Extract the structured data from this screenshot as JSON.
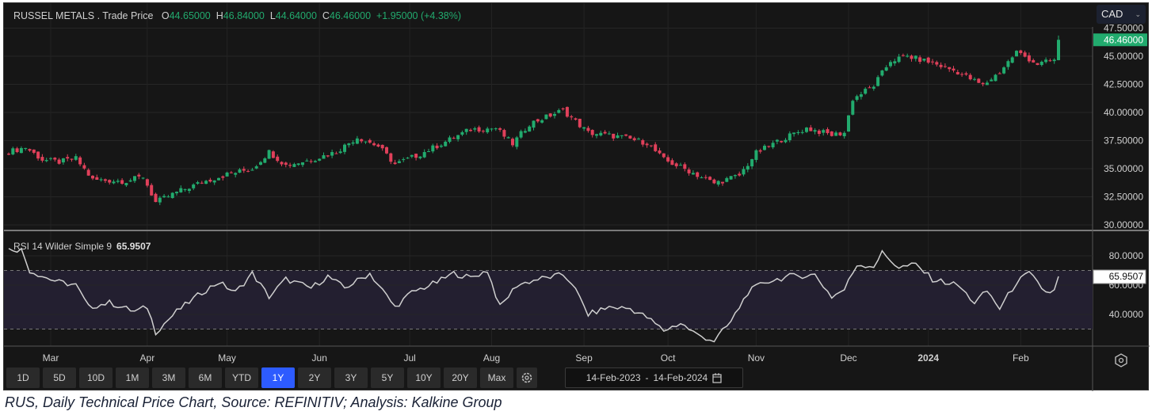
{
  "header": {
    "title": "RUSSEL METALS . Trade Price",
    "open_label": "O",
    "open": "44.65000",
    "high_label": "H",
    "high": "46.84000",
    "low_label": "L",
    "low": "44.64000",
    "close_label": "C",
    "close": "46.46000",
    "change": "+1.95000 (+4.38%)"
  },
  "currency": {
    "selected": "CAD"
  },
  "rsi": {
    "label": "RSI 14 Wilder Simple 9",
    "value": "65.9507"
  },
  "toolbar": {
    "ranges": [
      "1D",
      "5D",
      "10D",
      "1M",
      "3M",
      "6M",
      "YTD",
      "1Y",
      "2Y",
      "3Y",
      "5Y",
      "10Y",
      "20Y",
      "Max"
    ],
    "active": "1Y",
    "date_from": "14-Feb-2023",
    "date_sep": "-",
    "date_to": "14-Feb-2024"
  },
  "caption": "RUS, Daily Technical Price Chart, Source: REFINITIV; Analysis: Kalkine Group",
  "colors": {
    "up": "#22ab6e",
    "down": "#e0405a",
    "accent": "#2d5bff"
  },
  "chart_data": [
    {
      "type": "candlestick",
      "title": "RUSSEL METALS . Trade Price",
      "ylim": [
        30,
        47.5
      ],
      "yticks": [
        "47.50000",
        "45.00000",
        "42.50000",
        "40.00000",
        "37.50000",
        "35.00000",
        "32.50000",
        "30.00000"
      ],
      "last_price": "46.46000",
      "xticks": [
        {
          "label": "Mar",
          "day": 10
        },
        {
          "label": "Apr",
          "day": 33
        },
        {
          "label": "May",
          "day": 52
        },
        {
          "label": "Jun",
          "day": 74
        },
        {
          "label": "Jul",
          "day": 95.5
        },
        {
          "label": "Aug",
          "day": 115
        },
        {
          "label": "Sep",
          "day": 137
        },
        {
          "label": "Oct",
          "day": 157
        },
        {
          "label": "Nov",
          "day": 178
        },
        {
          "label": "Dec",
          "day": 200
        },
        {
          "label": "2024",
          "day": 219
        },
        {
          "label": "Feb",
          "day": 241
        }
      ],
      "close_keypoints": [
        [
          0,
          36.5
        ],
        [
          4,
          36.9
        ],
        [
          8,
          35.8
        ],
        [
          12,
          35.6
        ],
        [
          16,
          35.9
        ],
        [
          20,
          34.0
        ],
        [
          28,
          33.9
        ],
        [
          32,
          34.3
        ],
        [
          35,
          32.0
        ],
        [
          40,
          32.9
        ],
        [
          46,
          33.8
        ],
        [
          52,
          34.5
        ],
        [
          58,
          35.0
        ],
        [
          62,
          36.5
        ],
        [
          66,
          35.3
        ],
        [
          72,
          35.8
        ],
        [
          78,
          36.5
        ],
        [
          83,
          37.8
        ],
        [
          88,
          37.0
        ],
        [
          92,
          35.4
        ],
        [
          98,
          36.3
        ],
        [
          104,
          37.4
        ],
        [
          110,
          38.5
        ],
        [
          116,
          38.6
        ],
        [
          120,
          37.2
        ],
        [
          124,
          39.0
        ],
        [
          132,
          40.2
        ],
        [
          138,
          38.2
        ],
        [
          146,
          37.8
        ],
        [
          152,
          37.3
        ],
        [
          156,
          35.8
        ],
        [
          162,
          34.8
        ],
        [
          168,
          33.7
        ],
        [
          174,
          34.4
        ],
        [
          178,
          36.4
        ],
        [
          184,
          37.6
        ],
        [
          190,
          38.6
        ],
        [
          196,
          38.0
        ],
        [
          199,
          38.2
        ],
        [
          201,
          41.2
        ],
        [
          206,
          42.4
        ],
        [
          210,
          44.6
        ],
        [
          214,
          45.0
        ],
        [
          220,
          44.4
        ],
        [
          226,
          43.6
        ],
        [
          232,
          42.4
        ],
        [
          236,
          43.6
        ],
        [
          240,
          45.4
        ],
        [
          245,
          44.3
        ],
        [
          249,
          44.65
        ],
        [
          250,
          46.46
        ]
      ],
      "last_candle": {
        "open": 44.65,
        "high": 46.84,
        "low": 44.64,
        "close": 46.46
      }
    },
    {
      "type": "line",
      "title": "RSI 14 Wilder Simple 9",
      "ylim": [
        15,
        95
      ],
      "yticks": [
        "80.0000",
        "60.0000",
        "40.0000"
      ],
      "bands": [
        30,
        70
      ],
      "keypoints": [
        [
          0,
          85
        ],
        [
          3,
          84
        ],
        [
          5,
          70
        ],
        [
          9,
          65
        ],
        [
          12,
          62
        ],
        [
          16,
          60
        ],
        [
          19,
          45
        ],
        [
          24,
          48
        ],
        [
          30,
          42
        ],
        [
          33,
          45
        ],
        [
          35,
          28
        ],
        [
          40,
          42
        ],
        [
          46,
          55
        ],
        [
          50,
          62
        ],
        [
          54,
          55
        ],
        [
          58,
          68
        ],
        [
          62,
          52
        ],
        [
          66,
          64
        ],
        [
          72,
          58
        ],
        [
          76,
          66
        ],
        [
          80,
          58
        ],
        [
          86,
          68
        ],
        [
          92,
          45
        ],
        [
          96,
          55
        ],
        [
          102,
          62
        ],
        [
          106,
          68
        ],
        [
          110,
          65
        ],
        [
          114,
          70
        ],
        [
          117,
          45
        ],
        [
          121,
          60
        ],
        [
          126,
          64
        ],
        [
          132,
          67
        ],
        [
          134,
          62
        ],
        [
          138,
          40
        ],
        [
          143,
          45
        ],
        [
          148,
          44
        ],
        [
          152,
          38
        ],
        [
          156,
          29
        ],
        [
          160,
          34
        ],
        [
          164,
          26
        ],
        [
          168,
          22
        ],
        [
          172,
          35
        ],
        [
          176,
          55
        ],
        [
          180,
          62
        ],
        [
          186,
          66
        ],
        [
          192,
          67
        ],
        [
          196,
          52
        ],
        [
          199,
          57
        ],
        [
          202,
          74
        ],
        [
          206,
          73
        ],
        [
          208,
          82
        ],
        [
          212,
          72
        ],
        [
          216,
          74
        ],
        [
          220,
          64
        ],
        [
          226,
          60
        ],
        [
          230,
          48
        ],
        [
          233,
          56
        ],
        [
          236,
          44
        ],
        [
          240,
          62
        ],
        [
          243,
          68
        ],
        [
          247,
          55
        ],
        [
          249,
          56
        ],
        [
          250,
          65.95
        ]
      ]
    }
  ]
}
